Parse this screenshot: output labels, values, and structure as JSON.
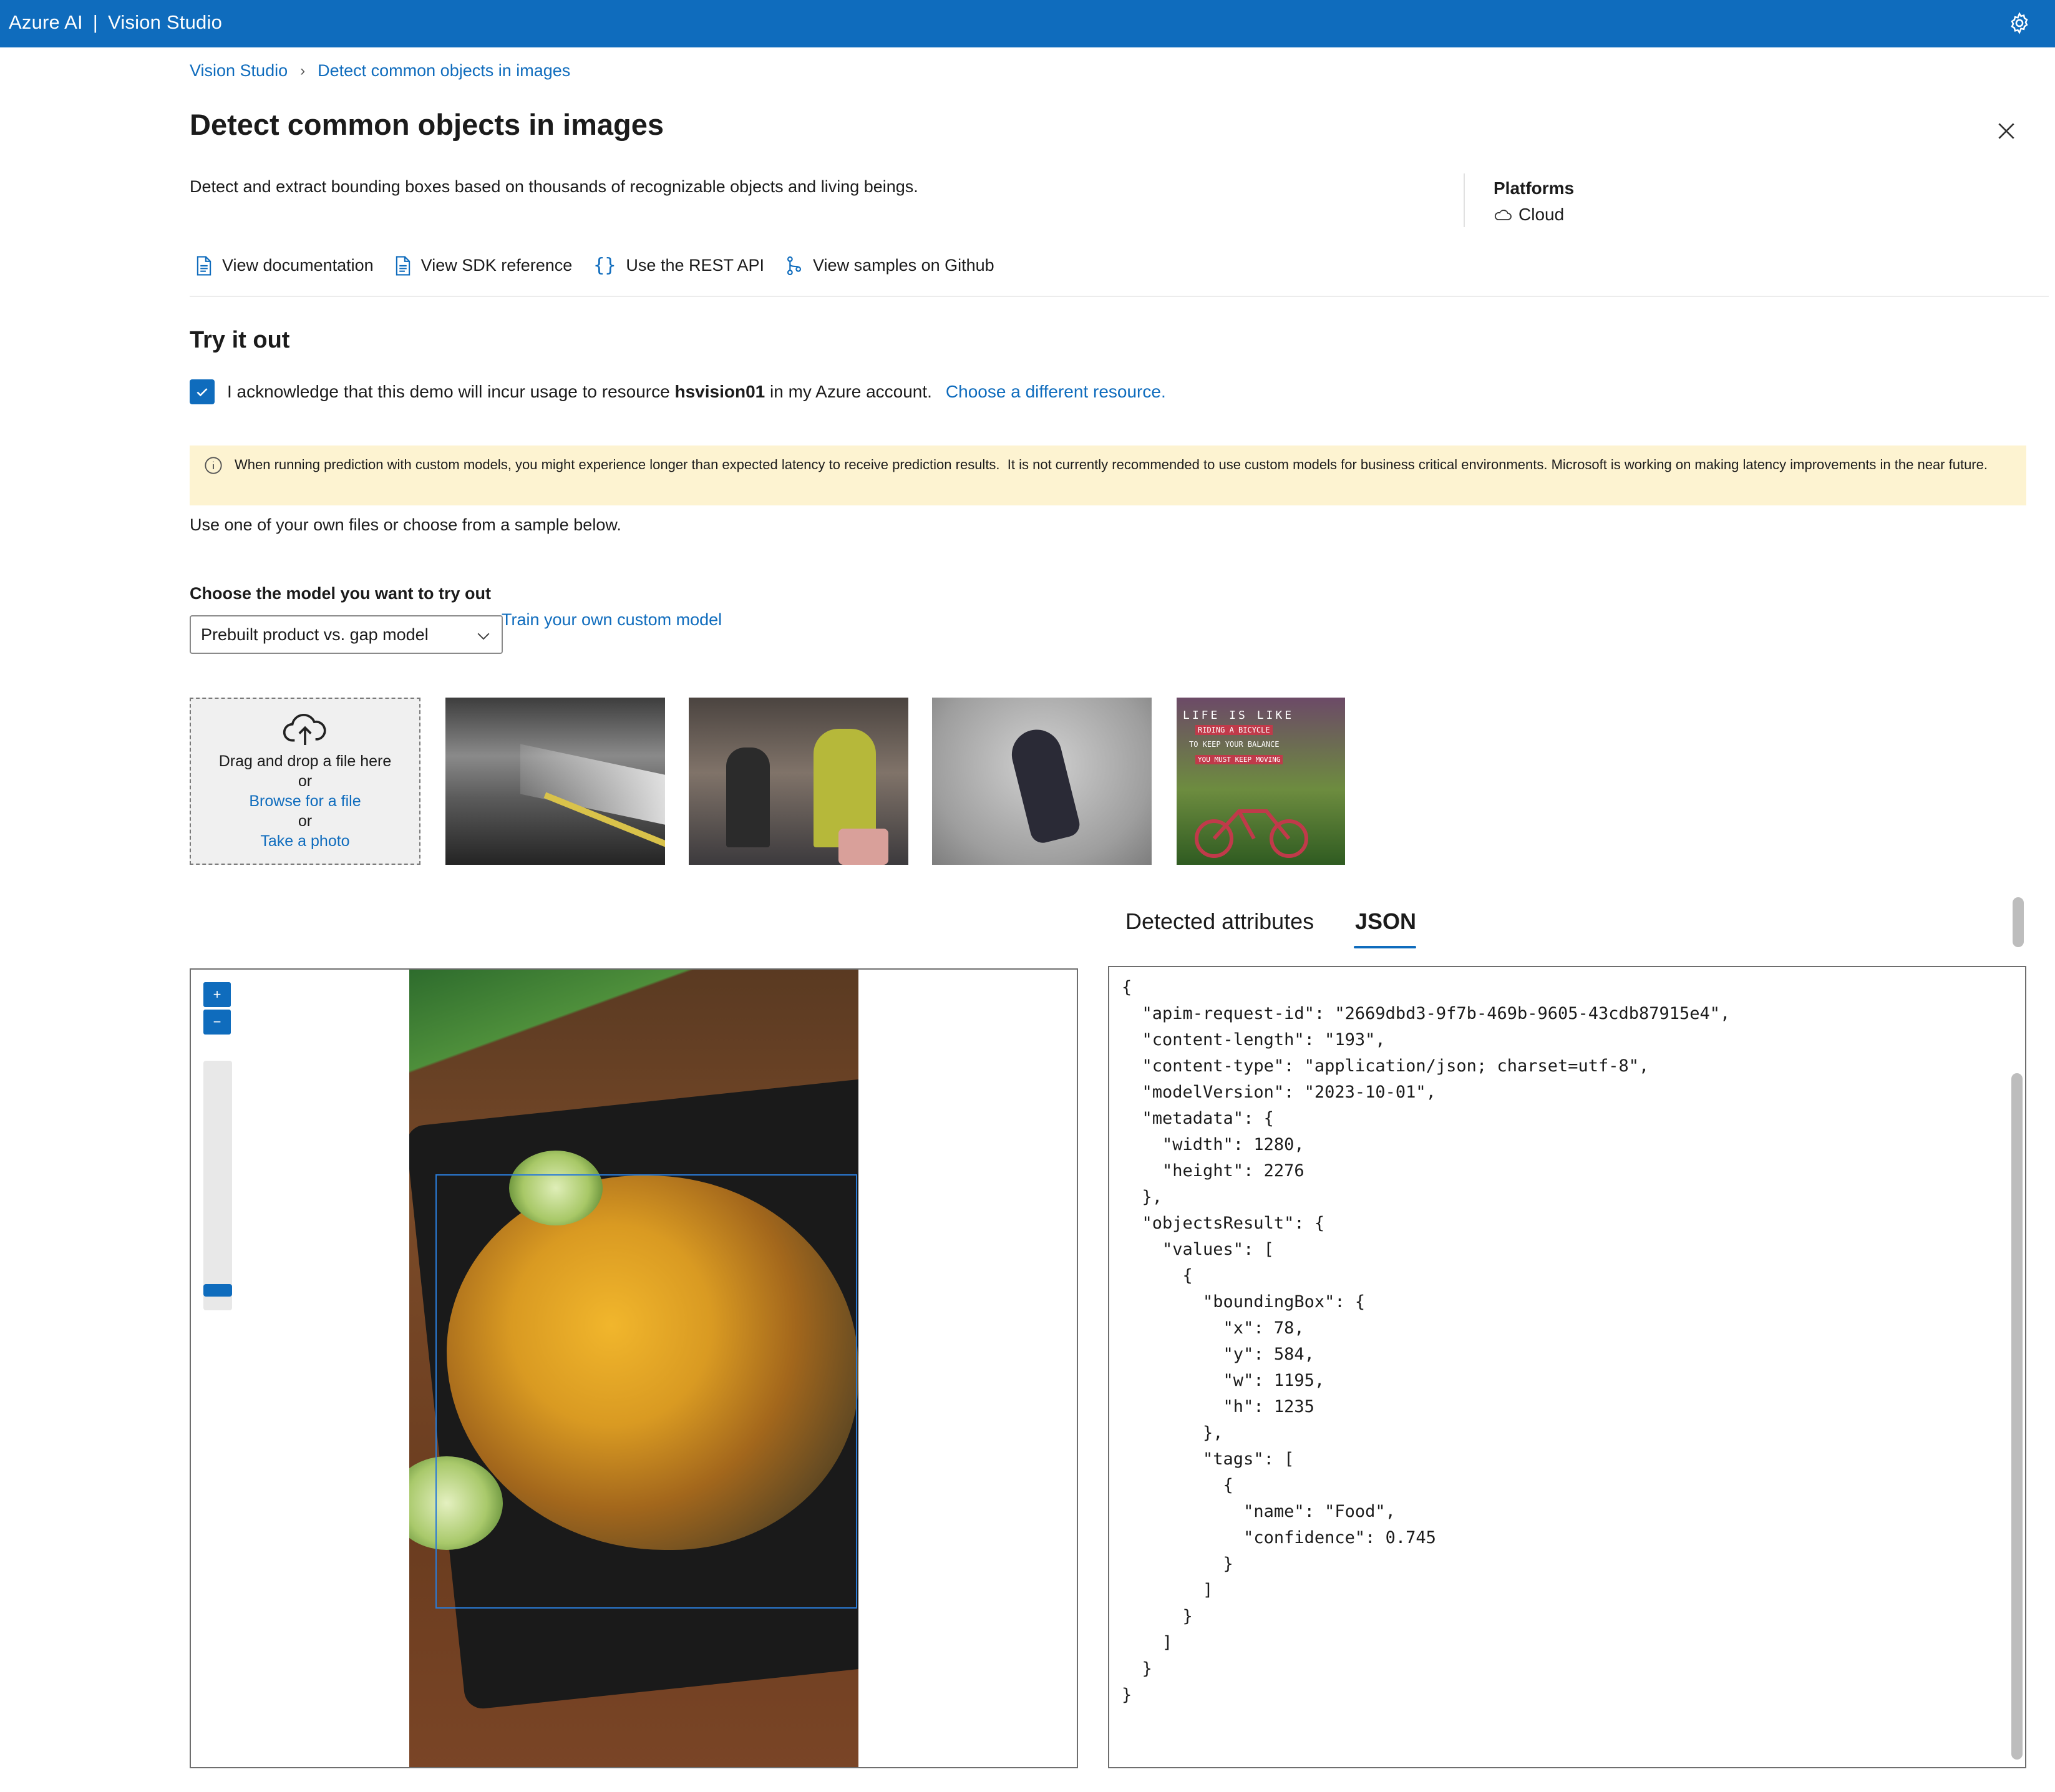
{
  "topbar": {
    "brand": "Azure AI",
    "product": "Vision Studio",
    "settings_icon": "gear-icon"
  },
  "breadcrumb": {
    "home": "Vision Studio",
    "current": "Detect common objects in images"
  },
  "page": {
    "title": "Detect common objects in images",
    "description": "Detect and extract bounding boxes based on thousands of recognizable objects and living beings.",
    "platforms_label": "Platforms",
    "platform_value": "Cloud"
  },
  "links": [
    {
      "label": "View documentation",
      "icon": "document-icon"
    },
    {
      "label": "View SDK reference",
      "icon": "document-icon"
    },
    {
      "label": "Use the REST API",
      "icon": "braces-icon"
    },
    {
      "label": "View samples on Github",
      "icon": "branch-icon"
    }
  ],
  "tryit": {
    "heading": "Try it out",
    "ack_prefix": "I acknowledge that this demo will incur usage to resource ",
    "ack_resource": "hsvision01",
    "ack_suffix": " in my Azure account.",
    "ack_checked": true,
    "choose_link": "Choose a different resource.",
    "warning": "When running prediction with custom models, you might experience longer than expected latency to receive prediction results.  It is not currently recommended to use custom models for business critical environments. Microsoft is working on making latency improvements in the near future.",
    "use_files": "Use one of your own files or choose from a sample below.",
    "model_label": "Choose the model you want to try out",
    "model_selected": "Prebuilt product vs. gap model",
    "train_link": "Train your own custom model"
  },
  "dropzone": {
    "line1": "Drag and drop a file here",
    "or1": "or",
    "browse": "Browse for a file",
    "or2": "or",
    "photo": "Take a photo"
  },
  "thumbnail_text": {
    "t4_line1": "LIFE IS LIKE",
    "t4_line2": "RIDING A BICYCLE",
    "t4_line3": "TO KEEP YOUR BALANCE",
    "t4_line4": "YOU MUST KEEP MOVING"
  },
  "result_tabs": {
    "tab1": "Detected attributes",
    "tab2": "JSON",
    "active": "JSON"
  },
  "json_text": "{\n  \"apim-request-id\": \"2669dbd3-9f7b-469b-9605-43cdb87915e4\",\n  \"content-length\": \"193\",\n  \"content-type\": \"application/json; charset=utf-8\",\n  \"modelVersion\": \"2023-10-01\",\n  \"metadata\": {\n    \"width\": 1280,\n    \"height\": 2276\n  },\n  \"objectsResult\": {\n    \"values\": [\n      {\n        \"boundingBox\": {\n          \"x\": 78,\n          \"y\": 584,\n          \"w\": 1195,\n          \"h\": 1235\n        },\n        \"tags\": [\n          {\n            \"name\": \"Food\",\n            \"confidence\": 0.745\n          }\n        ]\n      }\n    ]\n  }\n}"
}
